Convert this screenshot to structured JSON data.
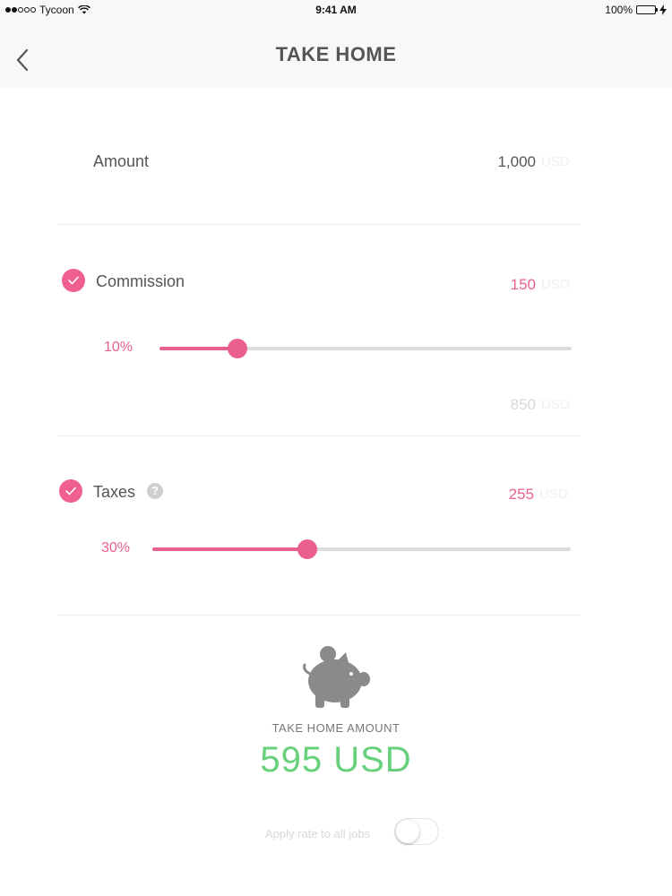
{
  "status_bar": {
    "carrier": "Tycoon",
    "time": "9:41 AM",
    "battery": "100%"
  },
  "nav": {
    "title": "TAKE HOME",
    "back_icon": "chevron-left-icon"
  },
  "amount": {
    "label": "Amount",
    "value": "1,000",
    "unit": "USD"
  },
  "commission": {
    "checked": true,
    "label": "Commission",
    "value": "150",
    "unit": "USD",
    "rate_label": "10%",
    "rate_fraction": 0.19,
    "remaining_value": "850",
    "remaining_unit": "USD"
  },
  "taxes": {
    "checked": true,
    "label": "Taxes",
    "help_icon": "question-icon",
    "help_symbol": "?",
    "value": "255",
    "unit": "USD",
    "rate_label": "30%",
    "rate_fraction": 0.37
  },
  "take_home": {
    "icon": "piggy-bank-icon",
    "label": "TAKE HOME AMOUNT",
    "amount": "595 USD"
  },
  "apply": {
    "label": "Apply rate to all jobs",
    "toggle_on": false
  },
  "colors": {
    "accent": "#ea5f8c",
    "positive": "#66d07a",
    "track": "#dcdcdc"
  }
}
